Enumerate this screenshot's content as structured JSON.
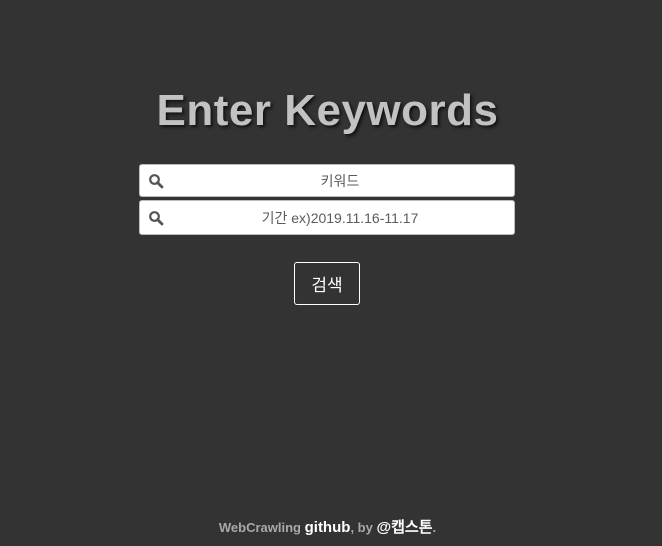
{
  "title": "Enter Keywords",
  "form": {
    "keyword_placeholder": "키워드",
    "keyword_value": "",
    "period_placeholder": "기간 ex)2019.11.16-11.17",
    "period_value": "",
    "search_icon": "magnifier-icon",
    "submit_label": "검색"
  },
  "footer": {
    "project": "WebCrawling",
    "github_link": "github",
    "by_text": ", by",
    "author_link": "@캡스톤",
    "period": "."
  },
  "colors": {
    "background": "#333333",
    "title": "#c2c2c2",
    "muted_text": "#a9a9a9",
    "link": "#ffffff"
  }
}
